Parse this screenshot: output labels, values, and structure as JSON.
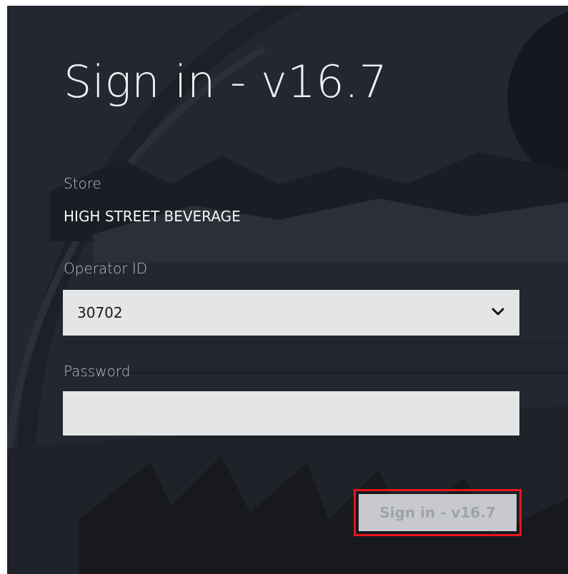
{
  "title": "Sign in - v16.7",
  "store": {
    "label": "Store",
    "value": "HIGH STREET BEVERAGE"
  },
  "operator": {
    "label": "Operator ID",
    "selected": "30702",
    "icon": "chevron-down-icon"
  },
  "password": {
    "label": "Password",
    "value": "",
    "placeholder": ""
  },
  "signin_button": {
    "label": "Sign in - v16.7"
  },
  "colors": {
    "background": "#23272f",
    "field": "#e4e5e6",
    "button": "#c7c9cc",
    "highlight": "#e8141b"
  }
}
